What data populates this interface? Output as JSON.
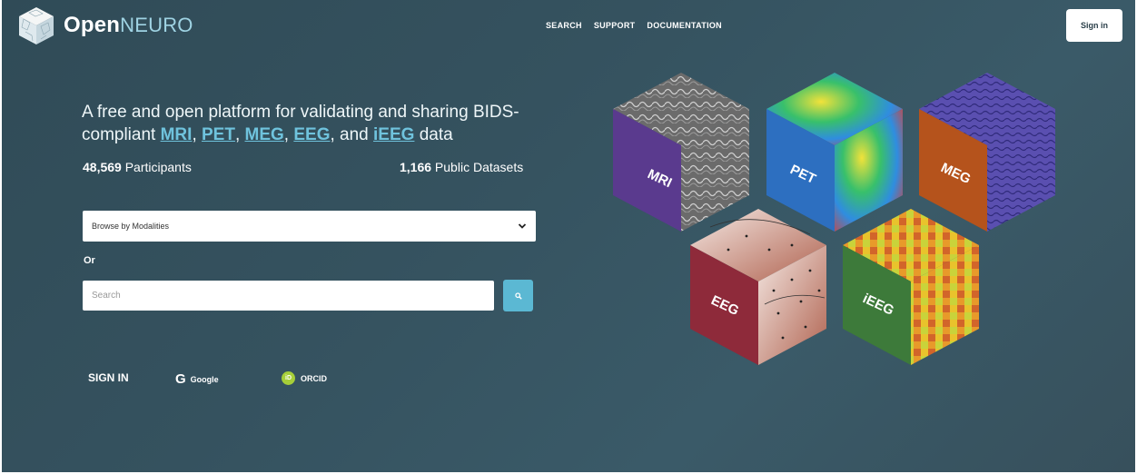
{
  "header": {
    "logo_open": "Open",
    "logo_neuro": "NEURO",
    "nav": [
      "SEARCH",
      "SUPPORT",
      "DOCUMENTATION"
    ],
    "signin": "Sign in"
  },
  "hero": {
    "tagline_prefix": "A free and open platform for validating and sharing BIDS-compliant ",
    "modalities": [
      "MRI",
      "PET",
      "MEG",
      "EEG",
      "iEEG"
    ],
    "sep1": ", ",
    "sep_and": ", and ",
    "tagline_suffix": " data",
    "participants_count": "48,569",
    "participants_label": " Participants",
    "datasets_count": "1,166",
    "datasets_label": " Public Datasets"
  },
  "browse": {
    "placeholder": "Browse by Modalities"
  },
  "or_label": "Or",
  "search": {
    "placeholder": "Search"
  },
  "signin_row": {
    "label": "SIGN IN",
    "google": "Google",
    "orcid": "ORCID",
    "orcid_icon": "iD"
  },
  "cubes": [
    {
      "label": "MRI",
      "side": "#5a3a8e"
    },
    {
      "label": "PET",
      "side": "#2d6fc0"
    },
    {
      "label": "MEG",
      "side": "#b5531c"
    },
    {
      "label": "EEG",
      "side": "#8e2a3a"
    },
    {
      "label": "iEEG",
      "side": "#3d7a3a"
    }
  ],
  "colors": {
    "accent": "#6fc3dd",
    "search_button": "#5bb8d3",
    "bg": "#35525f"
  }
}
